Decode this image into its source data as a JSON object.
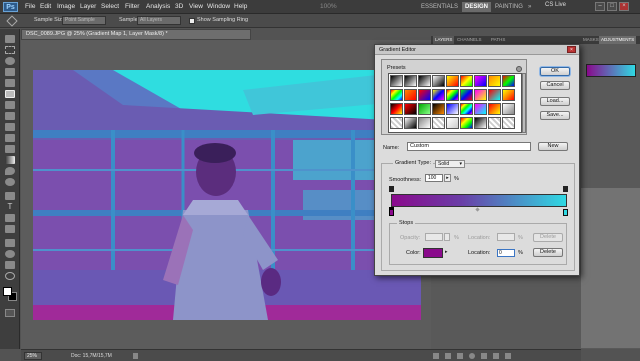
{
  "app": {
    "logo": "Ps",
    "workspace_buttons": [
      "ESSENTIALS",
      "DESIGN",
      "PAINTING"
    ],
    "more": "»",
    "cs_live": "CS Live",
    "zoom_top": "100%"
  },
  "menu": [
    "File",
    "Edit",
    "Image",
    "Layer",
    "Select",
    "Filter",
    "Analysis",
    "3D",
    "View",
    "Window",
    "Help"
  ],
  "options": {
    "sample_size_label": "Sample Size:",
    "sample_size_value": "Point Sample",
    "sample_label": "Sample:",
    "sample_value": "All Layers",
    "show_ring_label": "Show Sampling Ring"
  },
  "document": {
    "tab_title": "DSC_0089.JPG @ 25% (Gradient Map 1, Layer Mask/8) *",
    "zoom": "25%",
    "doc_size": "Doc: 15,7M/15,7M"
  },
  "panels": {
    "left_tabs": [
      "LAYERS",
      "CHANNELS",
      "PATHS"
    ],
    "right_tabs": [
      "MASKS",
      "ADJUSTMENTS"
    ]
  },
  "dialog": {
    "title": "Gradient Editor",
    "presets_label": "Presets",
    "buttons": {
      "ok": "OK",
      "cancel": "Cancel",
      "load": "Load...",
      "save": "Save...",
      "new": "New"
    },
    "name_label": "Name:",
    "name_value": "Custom",
    "gradient_type_label": "Gradient Type:",
    "gradient_type_value": "Solid",
    "smoothness_label": "Smoothness:",
    "smoothness_value": "100",
    "smoothness_unit": "%",
    "stops_label": "Stops",
    "opacity_label": "Opacity:",
    "opacity_unit": "%",
    "location_label": "Location:",
    "location_unit": "%",
    "location2_value": "0",
    "delete_label": "Delete",
    "color_label": "Color:",
    "gradient_start_color": "#8a0a8c",
    "gradient_end_color": "#2fd9e3"
  }
}
